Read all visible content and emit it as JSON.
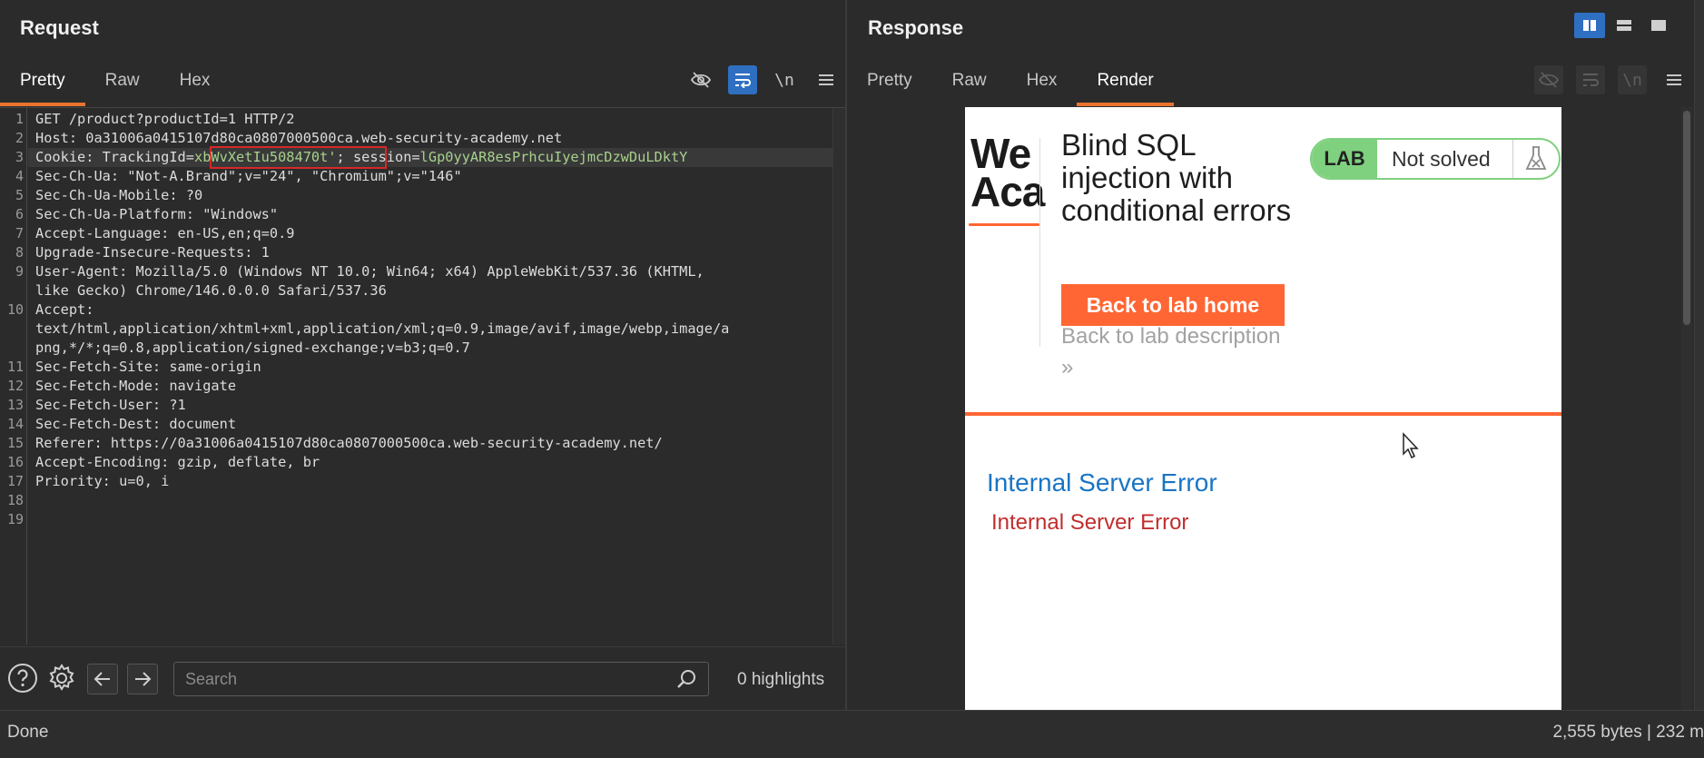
{
  "request": {
    "title": "Request",
    "tabs": [
      "Pretty",
      "Raw",
      "Hex"
    ],
    "active_tab": "Pretty",
    "newline_label": "\\n",
    "lines": [
      {
        "num": "1",
        "text": "GET /product?productId=1 HTTP/2"
      },
      {
        "num": "2",
        "text": "Host: 0a31006a0415107d80ca0807000500ca.web-security-academy.net"
      },
      {
        "num": "3",
        "prefix": "Cookie: TrackingId=",
        "tracking": "xbWvXetIu508470t'",
        "mid": "; session=",
        "session": "lGp0yyAR8esPrhcuIyejmcDzwDuLDktY"
      },
      {
        "num": "4",
        "text": "Sec-Ch-Ua: \"Not-A.Brand\";v=\"24\", \"Chromium\";v=\"146\""
      },
      {
        "num": "5",
        "text": "Sec-Ch-Ua-Mobile: ?0"
      },
      {
        "num": "6",
        "text": "Sec-Ch-Ua-Platform: \"Windows\""
      },
      {
        "num": "7",
        "text": "Accept-Language: en-US,en;q=0.9"
      },
      {
        "num": "8",
        "text": "Upgrade-Insecure-Requests: 1"
      },
      {
        "num": "9",
        "text": "User-Agent: Mozilla/5.0 (Windows NT 10.0; Win64; x64) AppleWebKit/537.36 (KHTML,"
      },
      {
        "num": "",
        "text": "like Gecko) Chrome/146.0.0.0 Safari/537.36"
      },
      {
        "num": "10",
        "text": "Accept:"
      },
      {
        "num": "",
        "text": "text/html,application/xhtml+xml,application/xml;q=0.9,image/avif,image/webp,image/a"
      },
      {
        "num": "",
        "text": "png,*/*;q=0.8,application/signed-exchange;v=b3;q=0.7"
      },
      {
        "num": "11",
        "text": "Sec-Fetch-Site: same-origin"
      },
      {
        "num": "12",
        "text": "Sec-Fetch-Mode: navigate"
      },
      {
        "num": "13",
        "text": "Sec-Fetch-User: ?1"
      },
      {
        "num": "14",
        "text": "Sec-Fetch-Dest: document"
      },
      {
        "num": "15",
        "text": "Referer: https://0a31006a0415107d80ca0807000500ca.web-security-academy.net/"
      },
      {
        "num": "16",
        "text": "Accept-Encoding: gzip, deflate, br"
      },
      {
        "num": "17",
        "text": "Priority: u=0, i"
      },
      {
        "num": "18",
        "text": ""
      },
      {
        "num": "19",
        "text": ""
      }
    ],
    "search": {
      "placeholder": "Search",
      "value": ""
    },
    "highlights": "0 highlights"
  },
  "response": {
    "title": "Response",
    "tabs": [
      "Pretty",
      "Raw",
      "Hex",
      "Render"
    ],
    "active_tab": "Render",
    "newline_label": "\\n",
    "render": {
      "logo_line1": "We",
      "logo_line2": "Aca",
      "lab_title": "Blind SQL injection with conditional errors",
      "back_home": "Back to lab home",
      "back_desc": "Back to lab description",
      "back_desc_arrow": "»",
      "badge_lab": "LAB",
      "badge_status": "Not solved",
      "error_title": "Internal Server Error",
      "error_text": "Internal Server Error"
    }
  },
  "status": {
    "left": "Done",
    "right": "2,555 bytes | 232 m"
  },
  "colors": {
    "accent_orange": "#e8742f",
    "toggle_blue": "#2f6fc1",
    "portswigger_orange": "#ff6633",
    "badge_green": "#7fd17f",
    "error_blue": "#1a74c3",
    "error_red": "#c12d2d",
    "cookie_box": "#d62828"
  }
}
